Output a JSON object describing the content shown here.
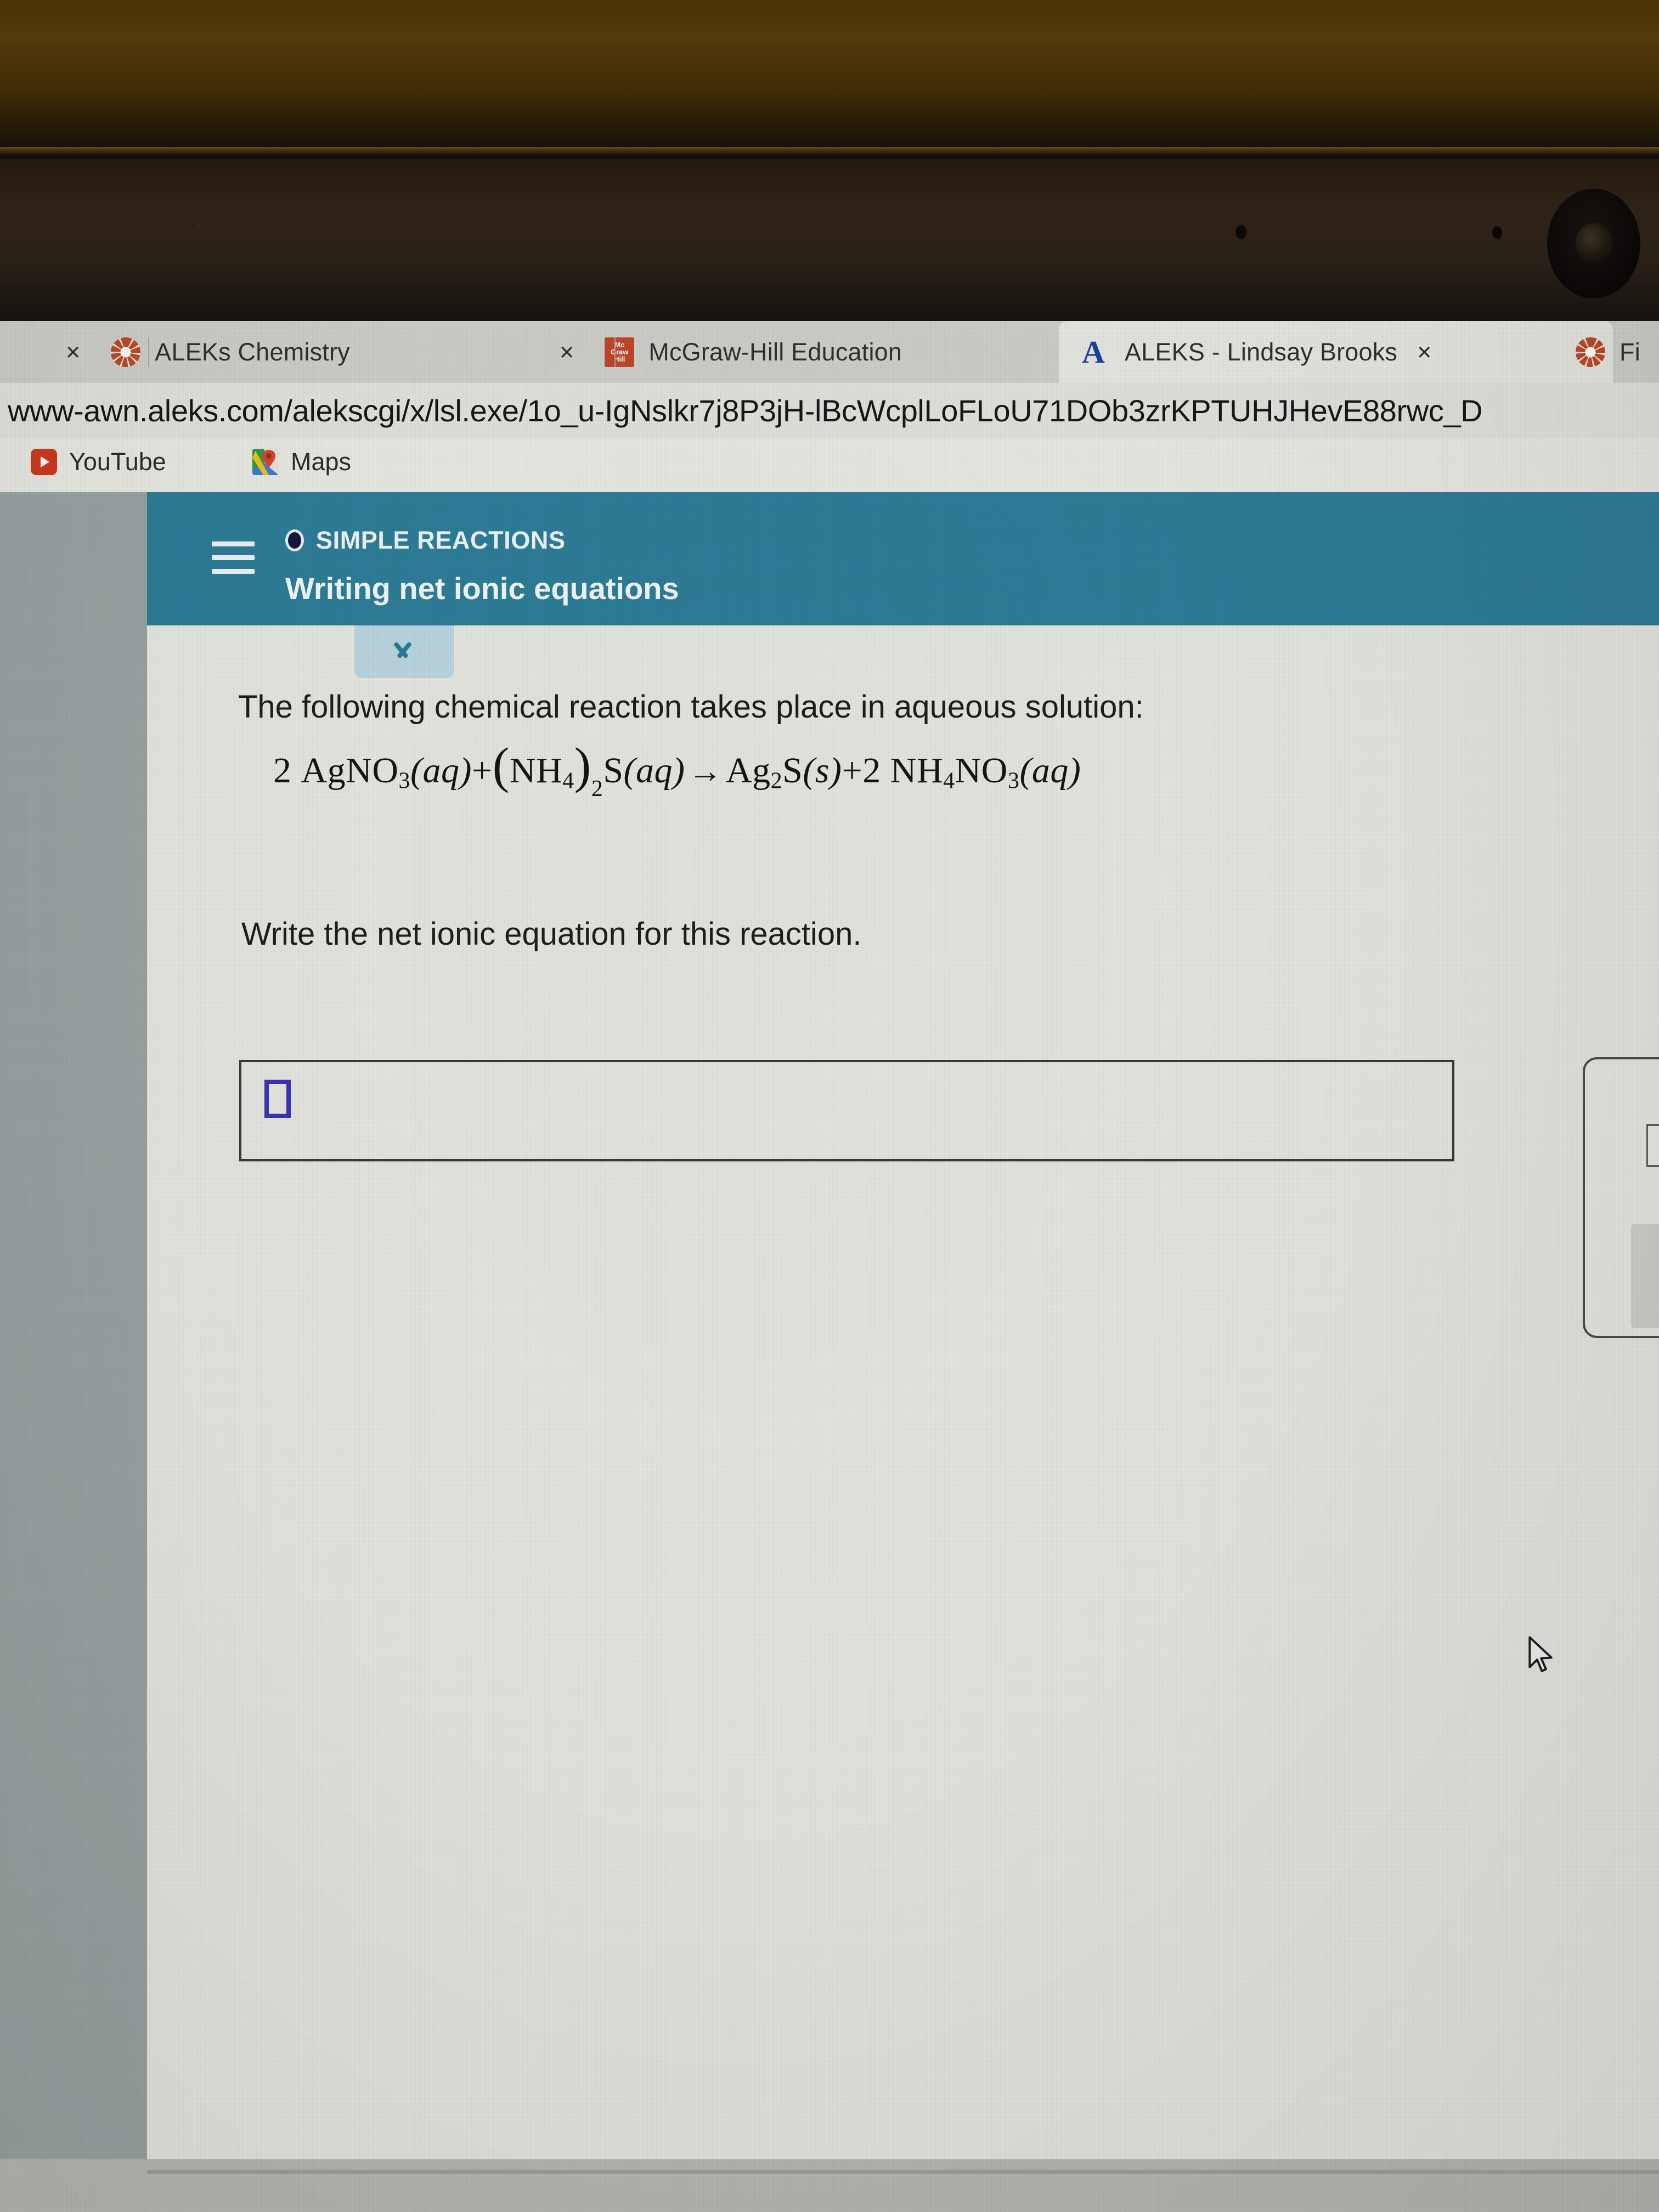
{
  "browser": {
    "tabs": [
      {
        "label": "ALEKs Chemistry",
        "icon": "aleks-icon",
        "close_label": "×",
        "active": false
      },
      {
        "label": "McGraw-Hill Education",
        "icon": "mcgraw-hill-icon",
        "close_label": "×",
        "active": false
      },
      {
        "label": "ALEKS - Lindsay Brooks",
        "icon": "aleks-letter-a-icon",
        "close_label": "×",
        "active": true
      },
      {
        "label": "Fi",
        "icon": "aleks-icon",
        "close_label": "×",
        "active": false
      }
    ],
    "mcgraw_icon_lines": [
      "Mc",
      "Graw",
      "Hill"
    ],
    "url": "www-awn.aleks.com/alekscgi/x/lsl.exe/1o_u-IgNslkr7j8P3jH-lBcWcplLoFLoU71DOb3zrKPTUHJHevE88rwc_D",
    "bookmarks": [
      {
        "label": "YouTube",
        "icon": "youtube-icon"
      },
      {
        "label": "Maps",
        "icon": "google-maps-icon"
      }
    ]
  },
  "aleks": {
    "menu_icon": "hamburger-menu-icon",
    "eyebrow": "SIMPLE REACTIONS",
    "title": "Writing net ionic equations",
    "collapse_icon": "chevron-down-icon",
    "question": {
      "intro": "The following chemical reaction takes place in aqueous solution:",
      "equation": {
        "coeff1": "2",
        "reactant1": "AgNO",
        "reactant1_sub": "3",
        "reactant1_state": "(aq)",
        "plus1": "+",
        "group_open": "(",
        "group": "NH",
        "group_sub": "4",
        "group_close": ")",
        "group_count": "2",
        "reactant2": "S",
        "reactant2_state": "(aq)",
        "arrow": "→",
        "product1": "Ag",
        "product1_sub": "2",
        "product1_s": "S",
        "product1_state": "(s)",
        "plus2": "+",
        "coeff2": "2",
        "product2a": "NH",
        "product2a_sub": "4",
        "product2b": "NO",
        "product2b_sub": "3",
        "product2_state": "(aq)",
        "plain_text": "2 AgNO3(aq) + (NH4)2S(aq) → Ag2S(s) + 2 NH4NO3(aq)"
      },
      "prompt": "Write the net ionic equation for this reaction."
    },
    "answer": {
      "value": "",
      "placeholder_caret": "empty-answer-placeholder"
    },
    "tool_panel": {
      "name": "equation-editor-toolbar"
    },
    "footer_buttons": [
      {
        "label": "",
        "style": "outline",
        "name": "explanation-button"
      },
      {
        "label": "",
        "style": "solid",
        "name": "check-button"
      }
    ]
  },
  "colors": {
    "aleks_teal": "#2e7e99",
    "collapse_tab": "#bcd8e2",
    "caret_blue": "#3b34b5",
    "mcgraw_red": "#c1472a",
    "aleks_blue_a": "#1f3f9e",
    "youtube_red": "#cf3b1c",
    "page_bg": "#e8e8e3",
    "gutter": "#9ba4a4"
  },
  "cursor": {
    "name": "mouse-pointer"
  }
}
